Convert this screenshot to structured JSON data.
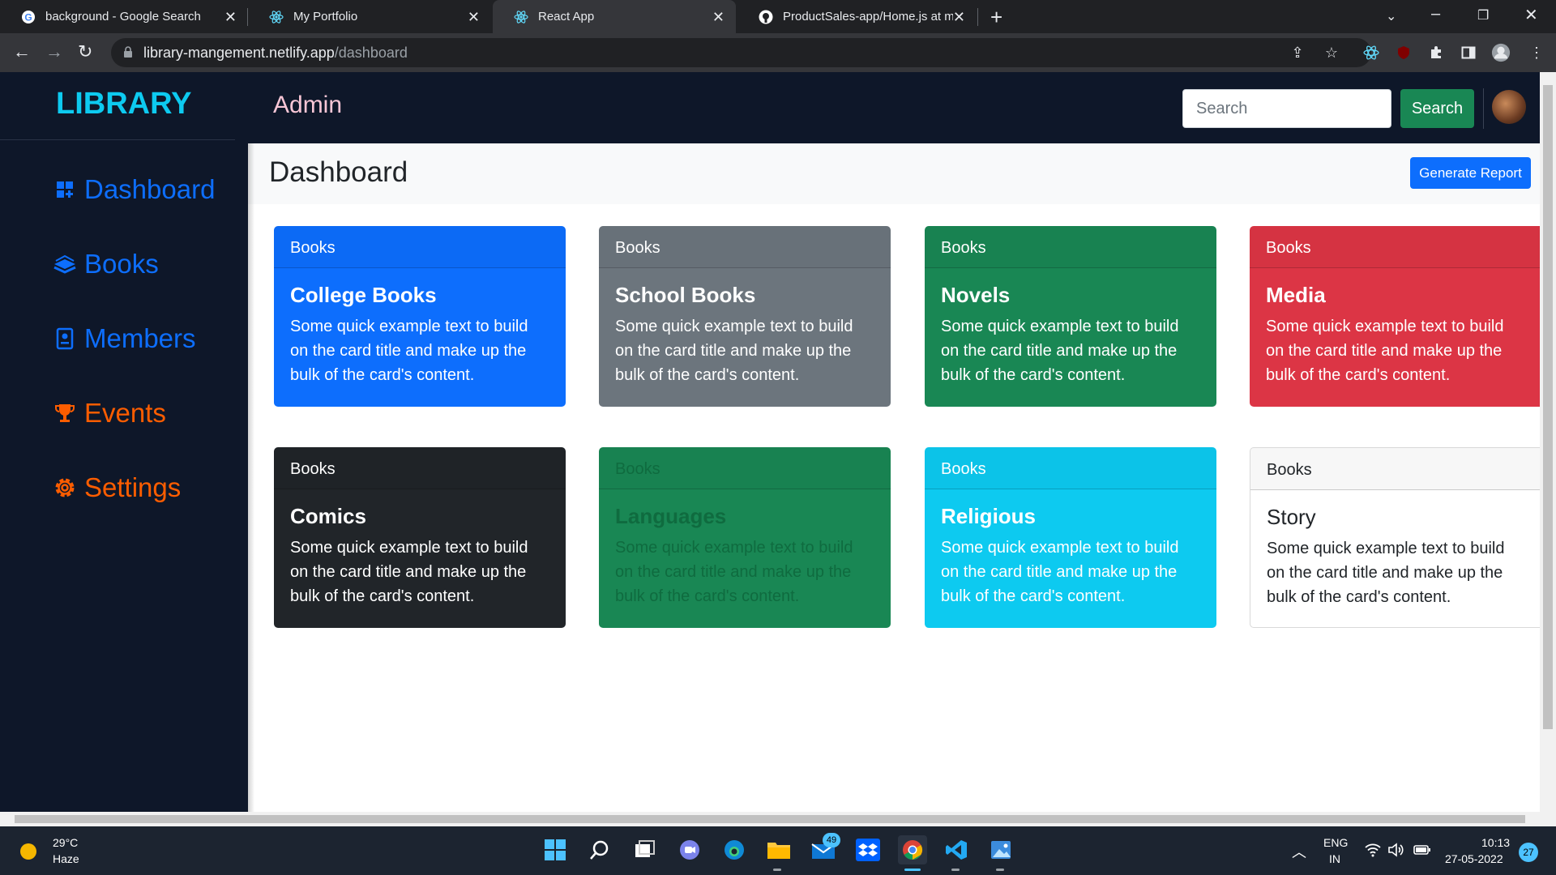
{
  "browser": {
    "tabs": [
      {
        "title": "background - Google Search"
      },
      {
        "title": "My Portfolio"
      },
      {
        "title": "React App"
      },
      {
        "title": "ProductSales-app/Home.js at ma"
      }
    ],
    "url_host": "library-mangement.netlify.app",
    "url_path": "/dashboard"
  },
  "app": {
    "brand": "LIBRARY",
    "role": "Admin",
    "search": {
      "placeholder": "Search",
      "button": "Search"
    },
    "sidebar": [
      {
        "label": "Dashboard",
        "icon": "dashboard-icon",
        "color": "#0d6efd"
      },
      {
        "label": "Books",
        "icon": "books-icon",
        "color": "#0d6efd"
      },
      {
        "label": "Members",
        "icon": "members-icon",
        "color": "#0d6efd"
      },
      {
        "label": "Events",
        "icon": "trophy-icon",
        "color": "#fd5d00"
      },
      {
        "label": "Settings",
        "icon": "gear-icon",
        "color": "#fd5d00"
      }
    ],
    "page_title": "Dashboard",
    "report_button": "Generate Report",
    "cards": [
      {
        "header": "Books",
        "title": "College Books",
        "text": "Some quick example text to build on the card title and make up the bulk of the card's content.",
        "bg": "#0d6efd",
        "fg": "#ffffff"
      },
      {
        "header": "Books",
        "title": "School Books",
        "text": "Some quick example text to build on the card title and make up the bulk of the card's content.",
        "bg": "#6c757d",
        "fg": "#ffffff"
      },
      {
        "header": "Books",
        "title": "Novels",
        "text": "Some quick example text to build on the card title and make up the bulk of the card's content.",
        "bg": "#198754",
        "fg": "#ffffff"
      },
      {
        "header": "Books",
        "title": "Media",
        "text": "Some quick example text to build on the card title and make up the bulk of the card's content.",
        "bg": "#dc3545",
        "fg": "#ffffff"
      },
      {
        "header": "Books",
        "title": "Comics",
        "text": "Some quick example text to build on the card title and make up the bulk of the card's content.",
        "bg": "#212529",
        "fg": "#ffffff"
      },
      {
        "header": "Books",
        "title": "Languages",
        "text": "Some quick example text to build on the card title and make up the bulk of the card's content.",
        "bg": "#198754",
        "fg": "#0f6b3f"
      },
      {
        "header": "Books",
        "title": "Religious",
        "text": "Some quick example text to build on the card title and make up the bulk of the card's content.",
        "bg": "#0dcaf0",
        "fg": "#ffffff"
      },
      {
        "header": "Books",
        "title": "Story",
        "text": "Some quick example text to build on the card title and make up the bulk of the card's content.",
        "bg": "#ffffff",
        "fg": "#212529"
      }
    ]
  },
  "taskbar": {
    "weather_temp": "29°C",
    "weather_desc": "Haze",
    "mail_badge": "49",
    "lang_top": "ENG",
    "lang_bottom": "IN",
    "time": "10:13",
    "date": "27-05-2022",
    "notifications": "27"
  }
}
